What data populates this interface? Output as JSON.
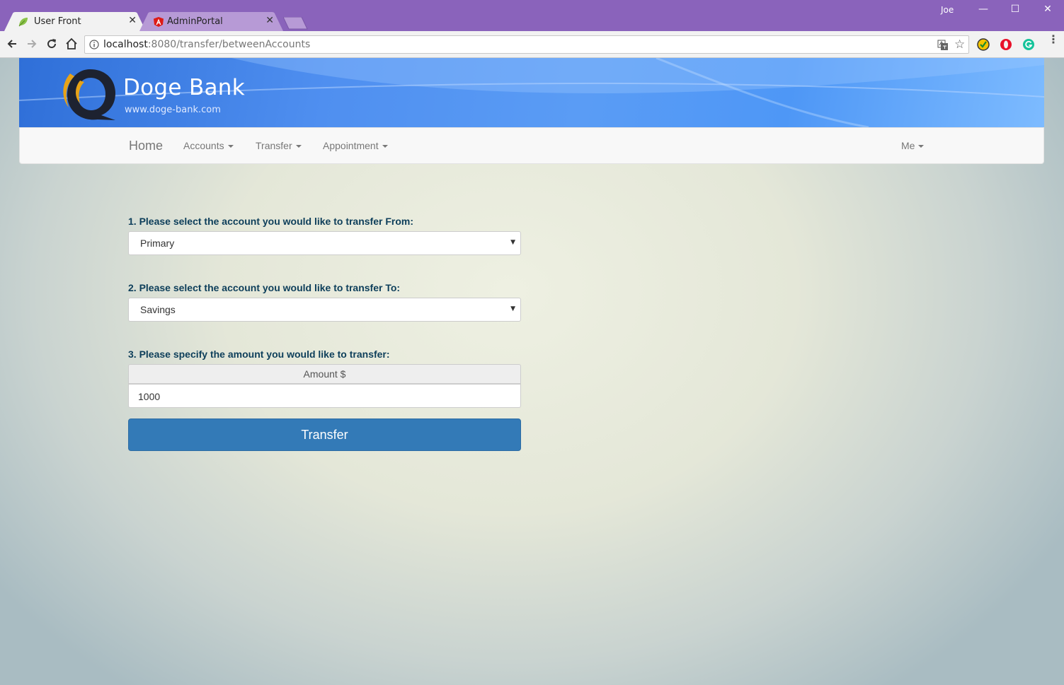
{
  "browser": {
    "tabs": [
      {
        "title": "User Front",
        "favicon": "leaf-icon",
        "active": true
      },
      {
        "title": "AdminPortal",
        "favicon": "angular-icon",
        "active": false
      }
    ],
    "close_glyph": "✕",
    "profile_name": "Joe",
    "window_controls": {
      "minimize": "—",
      "maximize": "☐",
      "close": "✕"
    },
    "url_host": "localhost",
    "url_rest": ":8080/transfer/betweenAccounts",
    "star_glyph": "☆",
    "extensions": [
      "norton-icon",
      "opera-icon",
      "grammarly-icon"
    ],
    "menu_glyph": "⋮"
  },
  "brand": {
    "name": "Doge Bank",
    "url": "www.doge-bank.com"
  },
  "nav": {
    "home": "Home",
    "items": [
      "Accounts",
      "Transfer",
      "Appointment"
    ],
    "right_item": "Me"
  },
  "form": {
    "from_label": "1. Please select the account you would like to transfer From:",
    "from_value": "Primary",
    "to_label": "2. Please select the account you would like to transfer To:",
    "to_value": "Savings",
    "amount_label": "3. Please specify the amount you would like to transfer:",
    "amount_addon": "Amount $",
    "amount_value": "1000",
    "submit_label": "Transfer",
    "select_arrow": "▼"
  },
  "colors": {
    "titlebar": "#8a63bb",
    "brand_banner": "#4f8ff0",
    "label_text": "#0d3e5a",
    "button_primary": "#337ab7"
  }
}
